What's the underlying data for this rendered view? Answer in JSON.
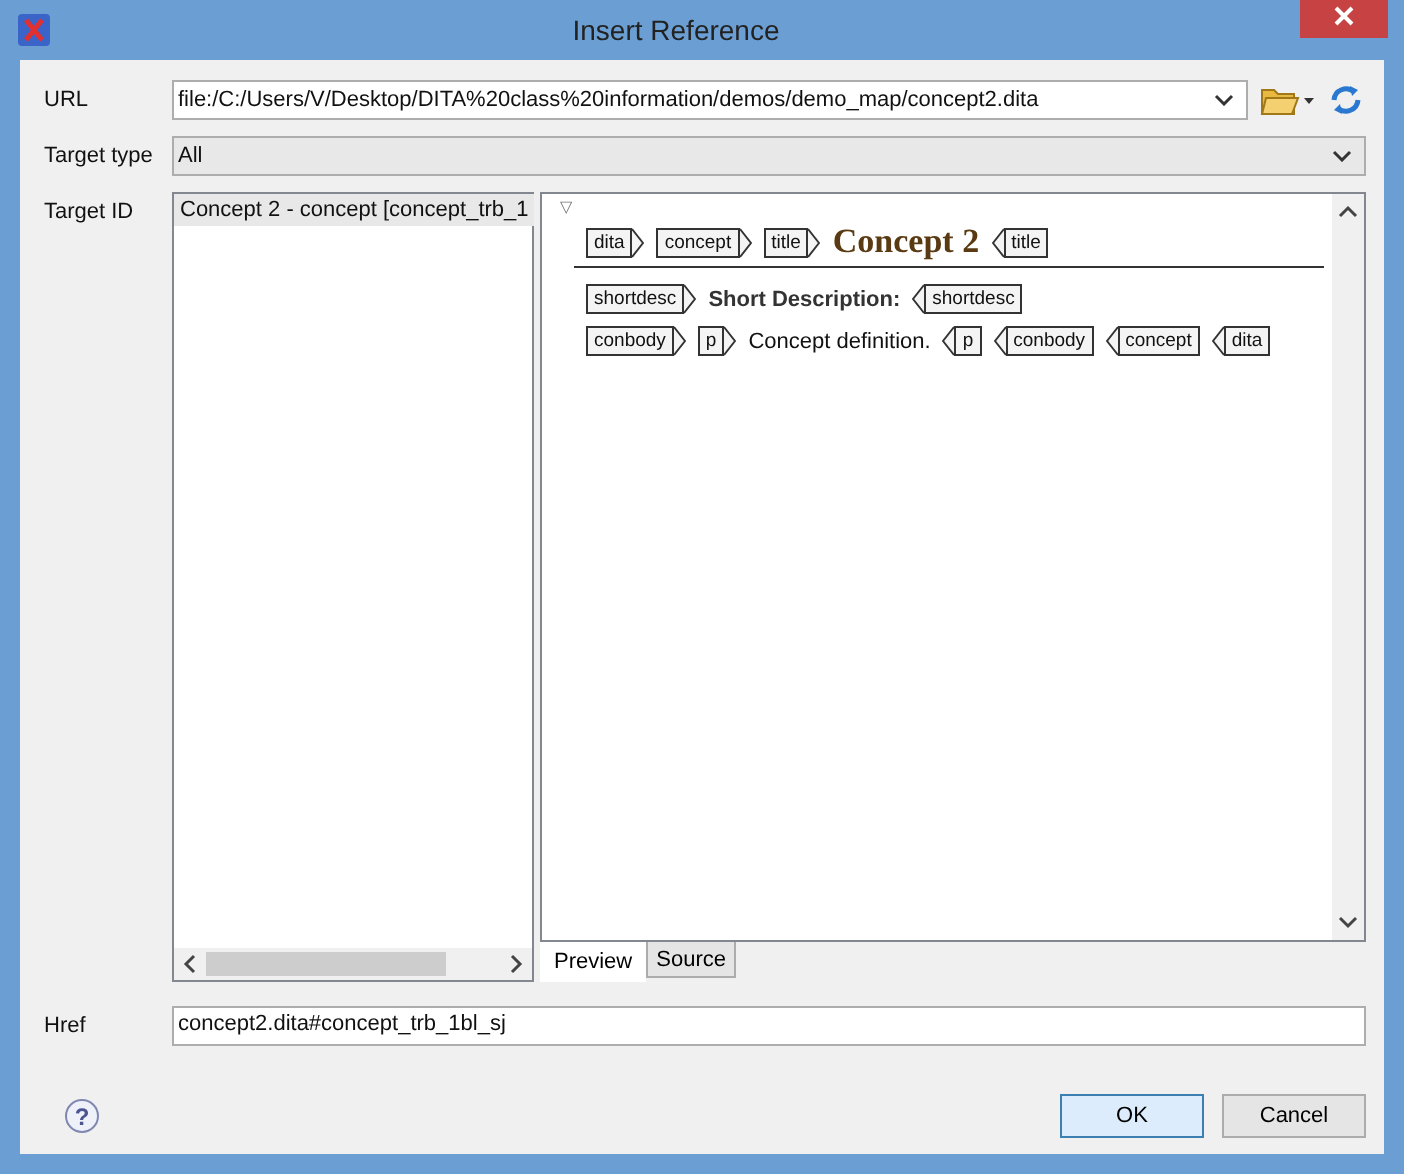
{
  "window": {
    "title": "Insert Reference"
  },
  "url": {
    "label": "URL",
    "value": "file:/C:/Users/V/Desktop/DITA%20class%20information/demos/demo_map/concept2.dita"
  },
  "target_type": {
    "label": "Target type",
    "value": "All"
  },
  "target_id": {
    "label": "Target ID",
    "items": [
      {
        "label": "Concept 2 - concept [concept_trb_1",
        "selected": true
      }
    ]
  },
  "preview": {
    "collapse_marker": "▽",
    "lines": [
      {
        "segments": [
          {
            "kind": "open",
            "text": "dita"
          },
          {
            "kind": "open",
            "text": "concept"
          },
          {
            "kind": "open",
            "text": "title"
          },
          {
            "kind": "title",
            "text": "Concept 2"
          },
          {
            "kind": "close",
            "text": "title"
          }
        ]
      },
      {
        "segments": [
          {
            "kind": "open",
            "text": "shortdesc"
          },
          {
            "kind": "bold",
            "text": "Short Description:"
          },
          {
            "kind": "close",
            "text": "shortdesc"
          }
        ]
      },
      {
        "segments": [
          {
            "kind": "open",
            "text": "conbody"
          },
          {
            "kind": "open",
            "text": "p"
          },
          {
            "kind": "text",
            "text": "Concept definition."
          },
          {
            "kind": "close",
            "text": "p"
          },
          {
            "kind": "close",
            "text": "conbody"
          },
          {
            "kind": "close",
            "text": "concept"
          },
          {
            "kind": "close",
            "text": "dita"
          }
        ]
      }
    ],
    "tabs": [
      {
        "label": "Preview",
        "selected": true
      },
      {
        "label": "Source",
        "selected": false
      }
    ]
  },
  "href": {
    "label": "Href",
    "value": "concept2.dita#concept_trb_1bl_sj"
  },
  "help": {
    "label": "?"
  },
  "buttons": [
    {
      "label": "OK",
      "default": true
    },
    {
      "label": "Cancel",
      "default": false
    }
  ]
}
